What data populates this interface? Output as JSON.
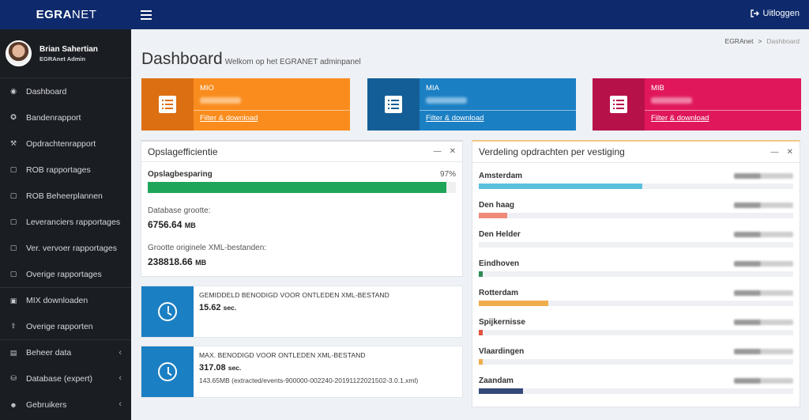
{
  "topbar": {
    "brand_bold": "EGRA",
    "brand_rest": "NET",
    "logout_label": "Uitloggen"
  },
  "user": {
    "name": "Brian Sahertian",
    "role": "EGRAnet Admin"
  },
  "sidebar": {
    "items": [
      {
        "label": "Dashboard",
        "icon": "dashboard-icon",
        "glyph": "◉"
      },
      {
        "label": "Bandenrapport",
        "icon": "tire-icon",
        "glyph": "✪"
      },
      {
        "label": "Opdrachtenrapport",
        "icon": "chart-icon",
        "glyph": "⚒"
      },
      {
        "label": "ROB rapportages",
        "icon": "file-icon",
        "glyph": "▢"
      },
      {
        "label": "ROB Beheerplannen",
        "icon": "file-icon",
        "glyph": "▢"
      },
      {
        "label": "Leveranciers rapportages",
        "icon": "file-icon",
        "glyph": "▢"
      },
      {
        "label": "Ver. vervoer rapportages",
        "icon": "file-icon",
        "glyph": "▢"
      },
      {
        "label": "Overige rapportages",
        "icon": "file-icon",
        "glyph": "▢"
      },
      {
        "label": "MIX downloaden",
        "icon": "excel-icon",
        "glyph": "▣"
      },
      {
        "label": "Overige rapporten",
        "icon": "upload-icon",
        "glyph": "⇪"
      },
      {
        "label": "Beheer data",
        "icon": "table-icon",
        "glyph": "▤"
      },
      {
        "label": "Database (expert)",
        "icon": "database-icon",
        "glyph": "⛁"
      },
      {
        "label": "Gebruikers",
        "icon": "users-icon",
        "glyph": "☻"
      }
    ]
  },
  "breadcrumb": {
    "root": "EGRAnet",
    "separator": ">",
    "current": "Dashboard"
  },
  "page": {
    "title": "Dashboard",
    "subtitle": "Welkom op het EGRANET adminpanel"
  },
  "stats": [
    {
      "label": "MIO",
      "link": "Filter & download",
      "color": "#f98c1d",
      "icon_bg": "#dc6f12"
    },
    {
      "label": "MIA",
      "link": "Filter & download",
      "color": "#1b7fc3",
      "icon_bg": "#145e97"
    },
    {
      "label": "MIB",
      "link": "Filter & download",
      "color": "#e0185b",
      "icon_bg": "#b7114a"
    }
  ],
  "efficiency": {
    "title": "Opslagefficientie",
    "progress_label": "Opslagbesparing",
    "progress_value": "97%",
    "progress_fraction": 0.97,
    "db_label": "Database grootte:",
    "db_value": "6756.64",
    "db_unit": "MB",
    "xml_label": "Grootte originele XML-bestanden:",
    "xml_value": "238818.66",
    "xml_unit": "MB"
  },
  "avg_parse": {
    "title": "GEMIDDELD BENODIGD VOOR ONTLEDEN XML-BESTAND",
    "value": "15.62",
    "unit": "sec."
  },
  "max_parse": {
    "title": "MAX. BENODIGD VOOR ONTLEDEN XML-BESTAND",
    "value": "317.08",
    "unit": "sec.",
    "note": "143.65MB (extracted/events-900000-002240-20191122021502-3.0.1.xml)"
  },
  "distribution": {
    "title": "Verdeling opdrachten per vestiging",
    "branches": [
      {
        "name": "Amsterdam",
        "fraction": 0.52,
        "color": "#5bc0de"
      },
      {
        "name": "Den haag",
        "fraction": 0.09,
        "color": "#f08a7a"
      },
      {
        "name": "Den Helder",
        "fraction": 0.0,
        "color": "#9aa0a6"
      },
      {
        "name": "Eindhoven",
        "fraction": 0.01,
        "color": "#2e8b57"
      },
      {
        "name": "Rotterdam",
        "fraction": 0.22,
        "color": "#f0ad4e"
      },
      {
        "name": "Spijkernisse",
        "fraction": 0.01,
        "color": "#e0533f"
      },
      {
        "name": "Vlaardingen",
        "fraction": 0.01,
        "color": "#f0ad4e"
      },
      {
        "name": "Zaandam",
        "fraction": 0.14,
        "color": "#34497a"
      }
    ]
  }
}
